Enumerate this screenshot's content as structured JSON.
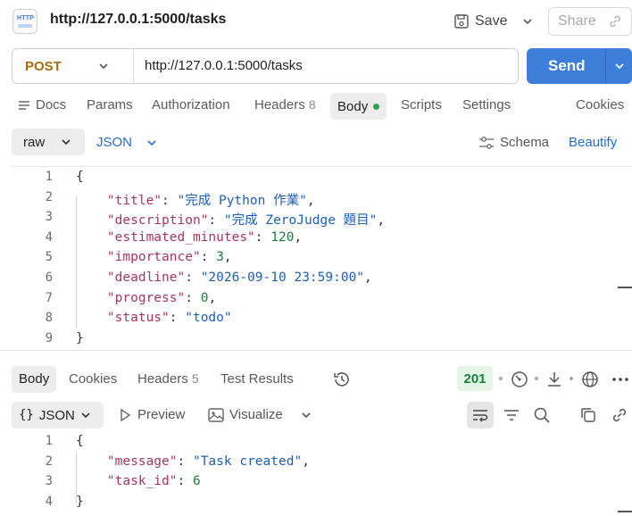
{
  "header": {
    "title": "http://127.0.0.1:5000/tasks",
    "icon_text": "HTTP",
    "save_label": "Save",
    "share_label": "Share"
  },
  "request": {
    "method": "POST",
    "url": "http://127.0.0.1:5000/tasks",
    "send_label": "Send"
  },
  "request_tabs": {
    "docs": "Docs",
    "params": "Params",
    "authorization": "Authorization",
    "headers": "Headers",
    "headers_count": "8",
    "body": "Body",
    "scripts": "Scripts",
    "settings": "Settings",
    "cookies": "Cookies"
  },
  "body_options": {
    "mode": "raw",
    "language": "JSON",
    "schema": "Schema",
    "beautify": "Beautify"
  },
  "request_body": [
    {
      "n": "1",
      "parts": [
        [
          "p",
          "{"
        ]
      ]
    },
    {
      "n": "2",
      "parts": [
        [
          "p",
          "    "
        ],
        [
          "k",
          "\"title\""
        ],
        [
          "p",
          ": "
        ],
        [
          "s",
          "\"完成 Python 作業\""
        ],
        [
          "p",
          ","
        ]
      ]
    },
    {
      "n": "3",
      "parts": [
        [
          "p",
          "    "
        ],
        [
          "k",
          "\"description\""
        ],
        [
          "p",
          ": "
        ],
        [
          "s",
          "\"完成 ZeroJudge 題目\""
        ],
        [
          "p",
          ","
        ]
      ]
    },
    {
      "n": "4",
      "parts": [
        [
          "p",
          "    "
        ],
        [
          "k",
          "\"estimated_minutes\""
        ],
        [
          "p",
          ": "
        ],
        [
          "n",
          "120"
        ],
        [
          "p",
          ","
        ]
      ]
    },
    {
      "n": "5",
      "parts": [
        [
          "p",
          "    "
        ],
        [
          "k",
          "\"importance\""
        ],
        [
          "p",
          ": "
        ],
        [
          "n",
          "3"
        ],
        [
          "p",
          ","
        ]
      ]
    },
    {
      "n": "6",
      "parts": [
        [
          "p",
          "    "
        ],
        [
          "k",
          "\"deadline\""
        ],
        [
          "p",
          ": "
        ],
        [
          "s",
          "\"2026-09-10 23:59:00\""
        ],
        [
          "p",
          ","
        ]
      ]
    },
    {
      "n": "7",
      "parts": [
        [
          "p",
          "    "
        ],
        [
          "k",
          "\"progress\""
        ],
        [
          "p",
          ": "
        ],
        [
          "n",
          "0"
        ],
        [
          "p",
          ","
        ]
      ]
    },
    {
      "n": "8",
      "parts": [
        [
          "p",
          "    "
        ],
        [
          "k",
          "\"status\""
        ],
        [
          "p",
          ": "
        ],
        [
          "s",
          "\"todo\""
        ]
      ]
    },
    {
      "n": "9",
      "parts": [
        [
          "p",
          "}"
        ]
      ]
    }
  ],
  "response_tabs": {
    "body": "Body",
    "cookies": "Cookies",
    "headers": "Headers",
    "headers_count": "5",
    "test_results": "Test Results",
    "status_code": "201"
  },
  "response_view": {
    "format": "JSON",
    "preview": "Preview",
    "visualize": "Visualize"
  },
  "response_body": [
    {
      "n": "1",
      "parts": [
        [
          "p",
          "{"
        ]
      ]
    },
    {
      "n": "2",
      "parts": [
        [
          "p",
          "    "
        ],
        [
          "k",
          "\"message\""
        ],
        [
          "p",
          ": "
        ],
        [
          "s",
          "\"Task created\""
        ],
        [
          "p",
          ","
        ]
      ]
    },
    {
      "n": "3",
      "parts": [
        [
          "p",
          "    "
        ],
        [
          "k",
          "\"task_id\""
        ],
        [
          "p",
          ": "
        ],
        [
          "n",
          "6"
        ]
      ]
    },
    {
      "n": "4",
      "parts": [
        [
          "p",
          "}"
        ]
      ]
    }
  ],
  "colors": {
    "accent": "#3d7ed8",
    "method_post": "#a76b0e",
    "json_key": "#a5365c",
    "json_string": "#1e5fb0",
    "json_number": "#1a7f3b",
    "status_success": "#1a7f3b"
  }
}
